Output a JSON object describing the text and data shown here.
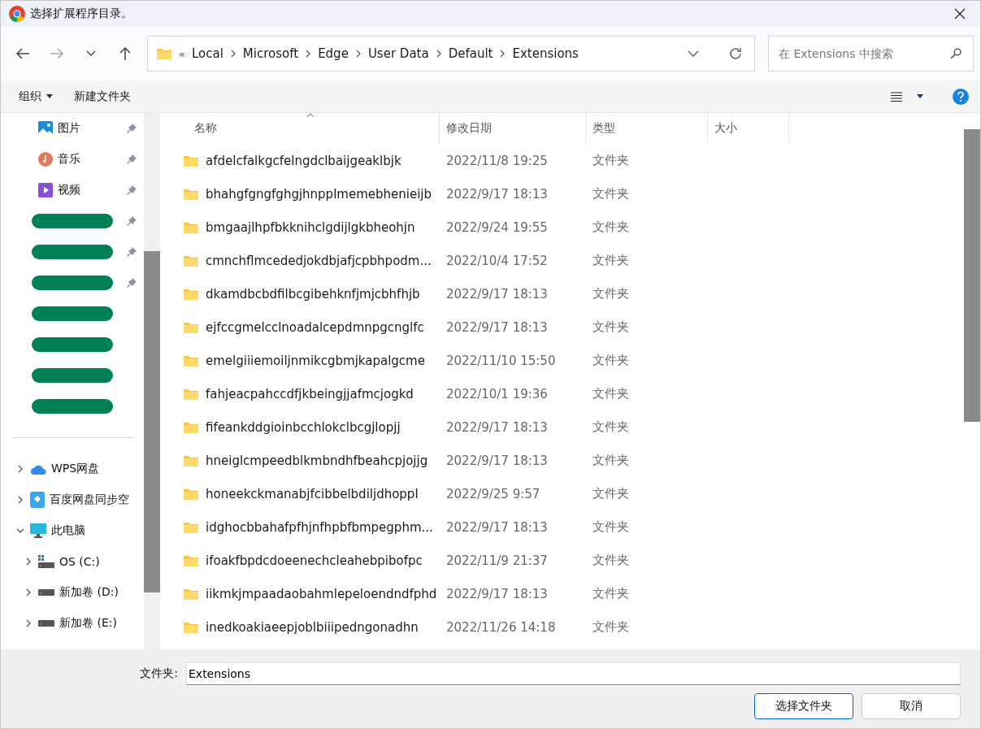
{
  "window": {
    "title": "选择扩展程序目录。"
  },
  "breadcrumb": {
    "overflow": "«",
    "segments": [
      "Local",
      "Microsoft",
      "Edge",
      "User Data",
      "Default",
      "Extensions"
    ]
  },
  "search": {
    "placeholder": "在 Extensions 中搜索"
  },
  "toolbar": {
    "organize": "组织",
    "new_folder": "新建文件夹"
  },
  "quick_access": [
    {
      "label": "图片",
      "kind": "pictures",
      "pinned": true
    },
    {
      "label": "音乐",
      "kind": "music",
      "pinned": true
    },
    {
      "label": "视频",
      "kind": "videos",
      "pinned": true
    },
    {
      "kind": "redacted",
      "pinned": true
    },
    {
      "kind": "redacted",
      "pinned": true
    },
    {
      "kind": "redacted",
      "pinned": true
    },
    {
      "kind": "redacted",
      "pinned": false
    },
    {
      "kind": "redacted",
      "pinned": false
    },
    {
      "kind": "redacted",
      "pinned": false
    },
    {
      "kind": "redacted",
      "pinned": false
    }
  ],
  "tree": [
    {
      "label": "WPS网盘",
      "kind": "cloud",
      "expanded": false
    },
    {
      "label": "百度网盘同步空",
      "kind": "sync",
      "expanded": false
    },
    {
      "label": "此电脑",
      "kind": "pc",
      "expanded": true,
      "children": [
        {
          "label": "OS (C:)",
          "kind": "system-drive",
          "expanded": false
        },
        {
          "label": "新加卷 (D:)",
          "kind": "drive",
          "expanded": false
        },
        {
          "label": "新加卷 (E:)",
          "kind": "drive",
          "expanded": false
        }
      ]
    }
  ],
  "table": {
    "columns": [
      "名称",
      "修改日期",
      "类型",
      "大小"
    ],
    "rows": [
      [
        "afdelcfalkgcfelngdclbaijgeaklbjk",
        "2022/11/8 19:25",
        "文件夹"
      ],
      [
        "bhahgfgngfghgjhnpplmemebhenieijb",
        "2022/9/17 18:13",
        "文件夹"
      ],
      [
        "bmgaajlhpfbkknihclgdijlgkbheohjn",
        "2022/9/24 19:55",
        "文件夹"
      ],
      [
        "cmnchflmcededjokdbjafjcpbhpodm...",
        "2022/10/4 17:52",
        "文件夹"
      ],
      [
        "dkamdbcbdfilbcgibehknfjmjcbhfhjb",
        "2022/9/17 18:13",
        "文件夹"
      ],
      [
        "ejfccgmelcclnoadalcepdmnpgcnglfc",
        "2022/9/17 18:13",
        "文件夹"
      ],
      [
        "emelgiiiemoiljnmikcgbmjkapalgcme",
        "2022/11/10 15:50",
        "文件夹"
      ],
      [
        "fahjeacpahccdfjkbeingjjafmcjogkd",
        "2022/10/1 19:36",
        "文件夹"
      ],
      [
        "fifeankddgioinbcchlokclbcgjlopjj",
        "2022/9/17 18:13",
        "文件夹"
      ],
      [
        "hneiglcmpeedblkmbndhfbeahcpjojjg",
        "2022/9/17 18:13",
        "文件夹"
      ],
      [
        "honeekckmanabjfcibbelbdiljdhoppl",
        "2022/9/25 9:57",
        "文件夹"
      ],
      [
        "idghocbbahafpfhjnfhpbfbmpegphm...",
        "2022/9/17 18:13",
        "文件夹"
      ],
      [
        "ifoakfbpdcdoeenechcleahebpibofpc",
        "2022/11/9 21:37",
        "文件夹"
      ],
      [
        "iikmkjmpaadaobahmlepeloendndfphd",
        "2022/9/17 18:13",
        "文件夹"
      ],
      [
        "inedkoakiaeepjoblbiiipedngonadhn",
        "2022/11/26 14:18",
        "文件夹"
      ]
    ]
  },
  "footer": {
    "label": "文件夹:",
    "value": "Extensions",
    "buttons": [
      "选择文件夹",
      "取消"
    ]
  }
}
